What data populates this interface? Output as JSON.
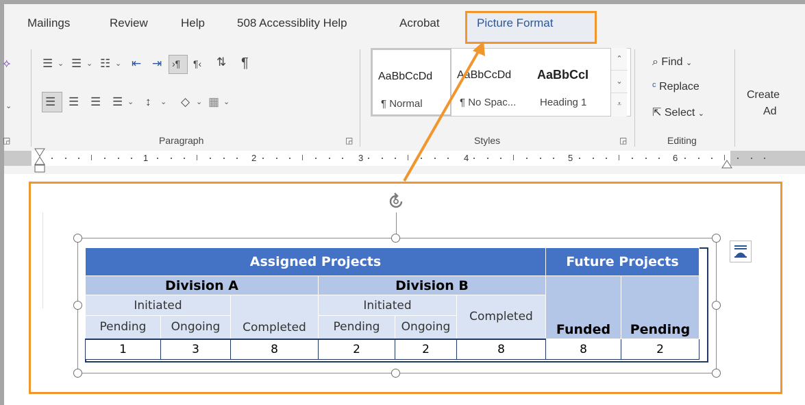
{
  "ribbon": {
    "tabs": [
      {
        "label": "Mailings",
        "active": false
      },
      {
        "label": "Review",
        "active": false
      },
      {
        "label": "Help",
        "active": false
      },
      {
        "label": "508 Accessiblity Help",
        "active": false
      },
      {
        "label": "Acrobat",
        "active": false
      },
      {
        "label": "Picture Format",
        "active": true
      }
    ],
    "groups": {
      "paragraph": "Paragraph",
      "styles": "Styles",
      "editing": "Editing"
    },
    "styles_gallery": [
      {
        "sample": "AaBbCcDd",
        "name": "¶ Normal"
      },
      {
        "sample": "AaBbCcDd",
        "name": "¶ No Spac..."
      },
      {
        "sample": "AaBbCcI",
        "name": "Heading 1"
      }
    ],
    "editing": {
      "find": "Find",
      "replace": "Replace",
      "select": "Select"
    },
    "create": {
      "line1": "Create",
      "line2": "Ad"
    }
  },
  "ruler": {
    "numbers": [
      "1",
      "2",
      "3",
      "4",
      "5",
      "6"
    ]
  },
  "table": {
    "assigned": "Assigned Projects",
    "future": "Future Projects",
    "division_a": "Division A",
    "division_b": "Division B",
    "initiated_a": "Initiated",
    "initiated_b": "Initiated",
    "completed_a": "Completed",
    "completed_b": "Completed",
    "funded": "Funded",
    "pending_future": "Pending",
    "sub_headers": [
      "Pending",
      "Ongoing",
      "Pending",
      "Ongoing"
    ],
    "values": [
      "1",
      "3",
      "8",
      "2",
      "2",
      "8",
      "8",
      "2"
    ]
  },
  "colors": {
    "accent_orange": "#f0962d",
    "table_header": "#4472c4",
    "table_sub": "#b4c6e7",
    "table_light": "#dae3f3",
    "active_tab": "#2b579a"
  }
}
